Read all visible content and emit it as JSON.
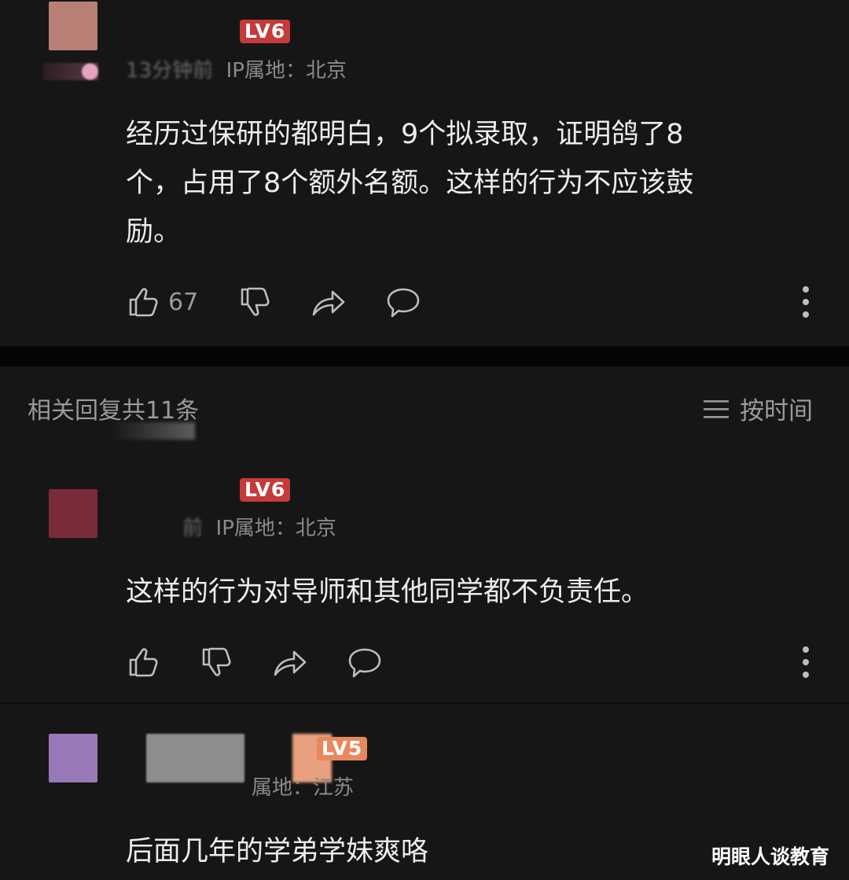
{
  "comments": [
    {
      "level": "LV6",
      "meta_time": "13分钟前",
      "meta_ip": "IP属地：北京",
      "text_lines": [
        "经历过保研的都明白，9个拟录取，证明鸽了8",
        "个，占用了8个额外名额。这样的行为不应该鼓",
        "励。"
      ],
      "like_count": "67",
      "avatar_color": "#b77f75"
    },
    {
      "level": "LV6",
      "meta_time": "前",
      "meta_ip": "IP属地：北京",
      "text": "这样的行为对导师和其他同学都不负责任。",
      "avatar_color": "#7a2b39"
    },
    {
      "level": "LV5",
      "meta_ip": "属地：江苏",
      "text": "后面几年的学弟学妹爽咯",
      "avatar_color": "#9878b6"
    }
  ],
  "replies_header": {
    "count_label": "相关回复共11条",
    "sort_label": "按时间"
  },
  "icons": [
    "like-icon",
    "dislike-icon",
    "share-icon",
    "comment-icon",
    "more-icon",
    "menu-lines-icon"
  ],
  "watermark": "明眼人谈教育",
  "colors": {
    "background": "#161616",
    "separator": "#050505",
    "badge_red": "#c53a3a",
    "badge_orange": "#e9875d"
  }
}
